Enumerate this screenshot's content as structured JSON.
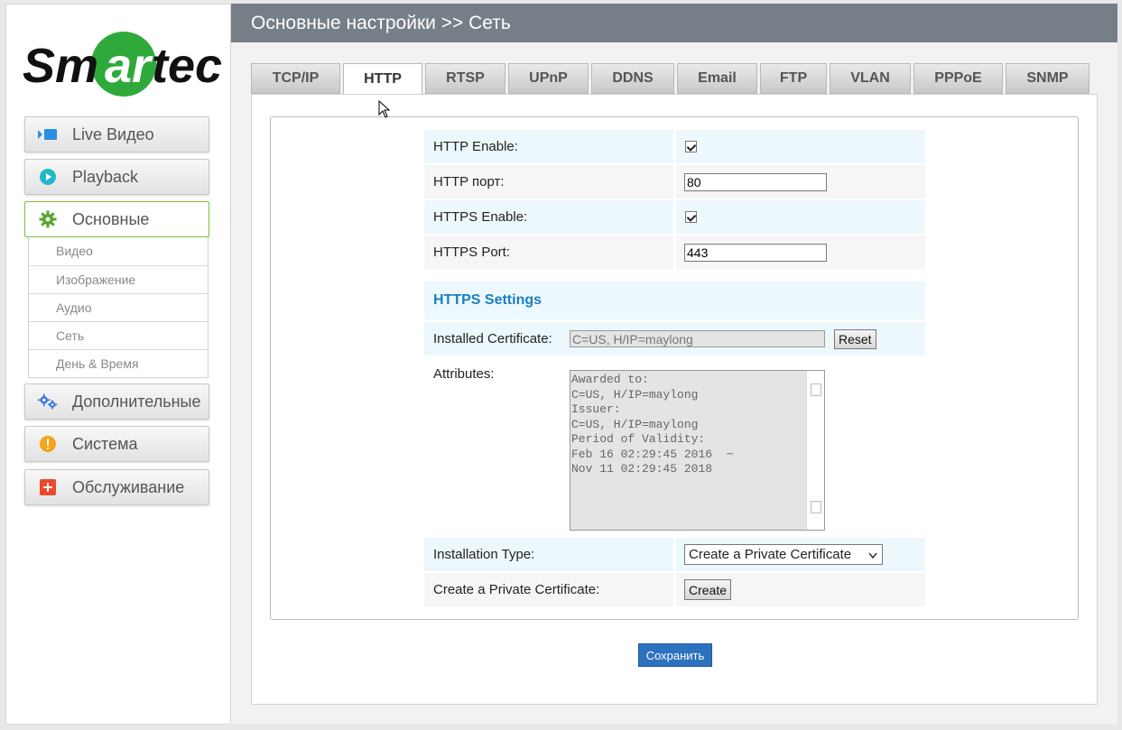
{
  "sidebar": {
    "logo_text": "Smartec",
    "nav": [
      {
        "label": "Live Видео",
        "icon": "camera-icon"
      },
      {
        "label": "Playback",
        "icon": "play-icon"
      },
      {
        "label": "Основные",
        "icon": "gear-icon",
        "active": true
      },
      {
        "label": "Дополнительные",
        "icon": "gears-icon"
      },
      {
        "label": "Система",
        "icon": "warning-icon"
      },
      {
        "label": "Обслуживание",
        "icon": "plus-icon"
      }
    ],
    "submenu": [
      "Видео",
      "Изображение",
      "Аудио",
      "Сеть",
      "День & Время"
    ]
  },
  "header": {
    "title": "Основные настройки >> Сеть"
  },
  "tabs": [
    "TCP/IP",
    "HTTP",
    "RTSP",
    "UPnP",
    "DDNS",
    "Email",
    "FTP",
    "VLAN",
    "PPPoE",
    "SNMP"
  ],
  "active_tab": "HTTP",
  "form": {
    "http_enable_label": "HTTP Enable:",
    "http_enable_checked": true,
    "http_port_label": "HTTP порт:",
    "http_port_value": "80",
    "https_enable_label": "HTTPS Enable:",
    "https_enable_checked": true,
    "https_port_label": "HTTPS Port:",
    "https_port_value": "443",
    "https_settings_title": "HTTPS Settings",
    "installed_cert_label": "Installed Certificate:",
    "installed_cert_value": "C=US, H/IP=maylong",
    "reset_label": "Reset",
    "attributes_label": "Attributes:",
    "attributes_text": "Awarded to:\nC=US, H/IP=maylong\nIssuer:\nC=US, H/IP=maylong\nPeriod of Validity:\nFeb 16 02:29:45 2016  ~\nNov 11 02:29:45 2018",
    "install_type_label": "Installation Type:",
    "install_type_value": "Create a Private Certificate",
    "create_private_label": "Create a Private Certificate:",
    "create_label": "Create"
  },
  "save_label": "Сохранить",
  "colors": {
    "header_bg": "#767e88",
    "accent_green": "#7bbf3a",
    "section_blue": "#1a7fbf",
    "save_blue": "#2d72bf"
  }
}
